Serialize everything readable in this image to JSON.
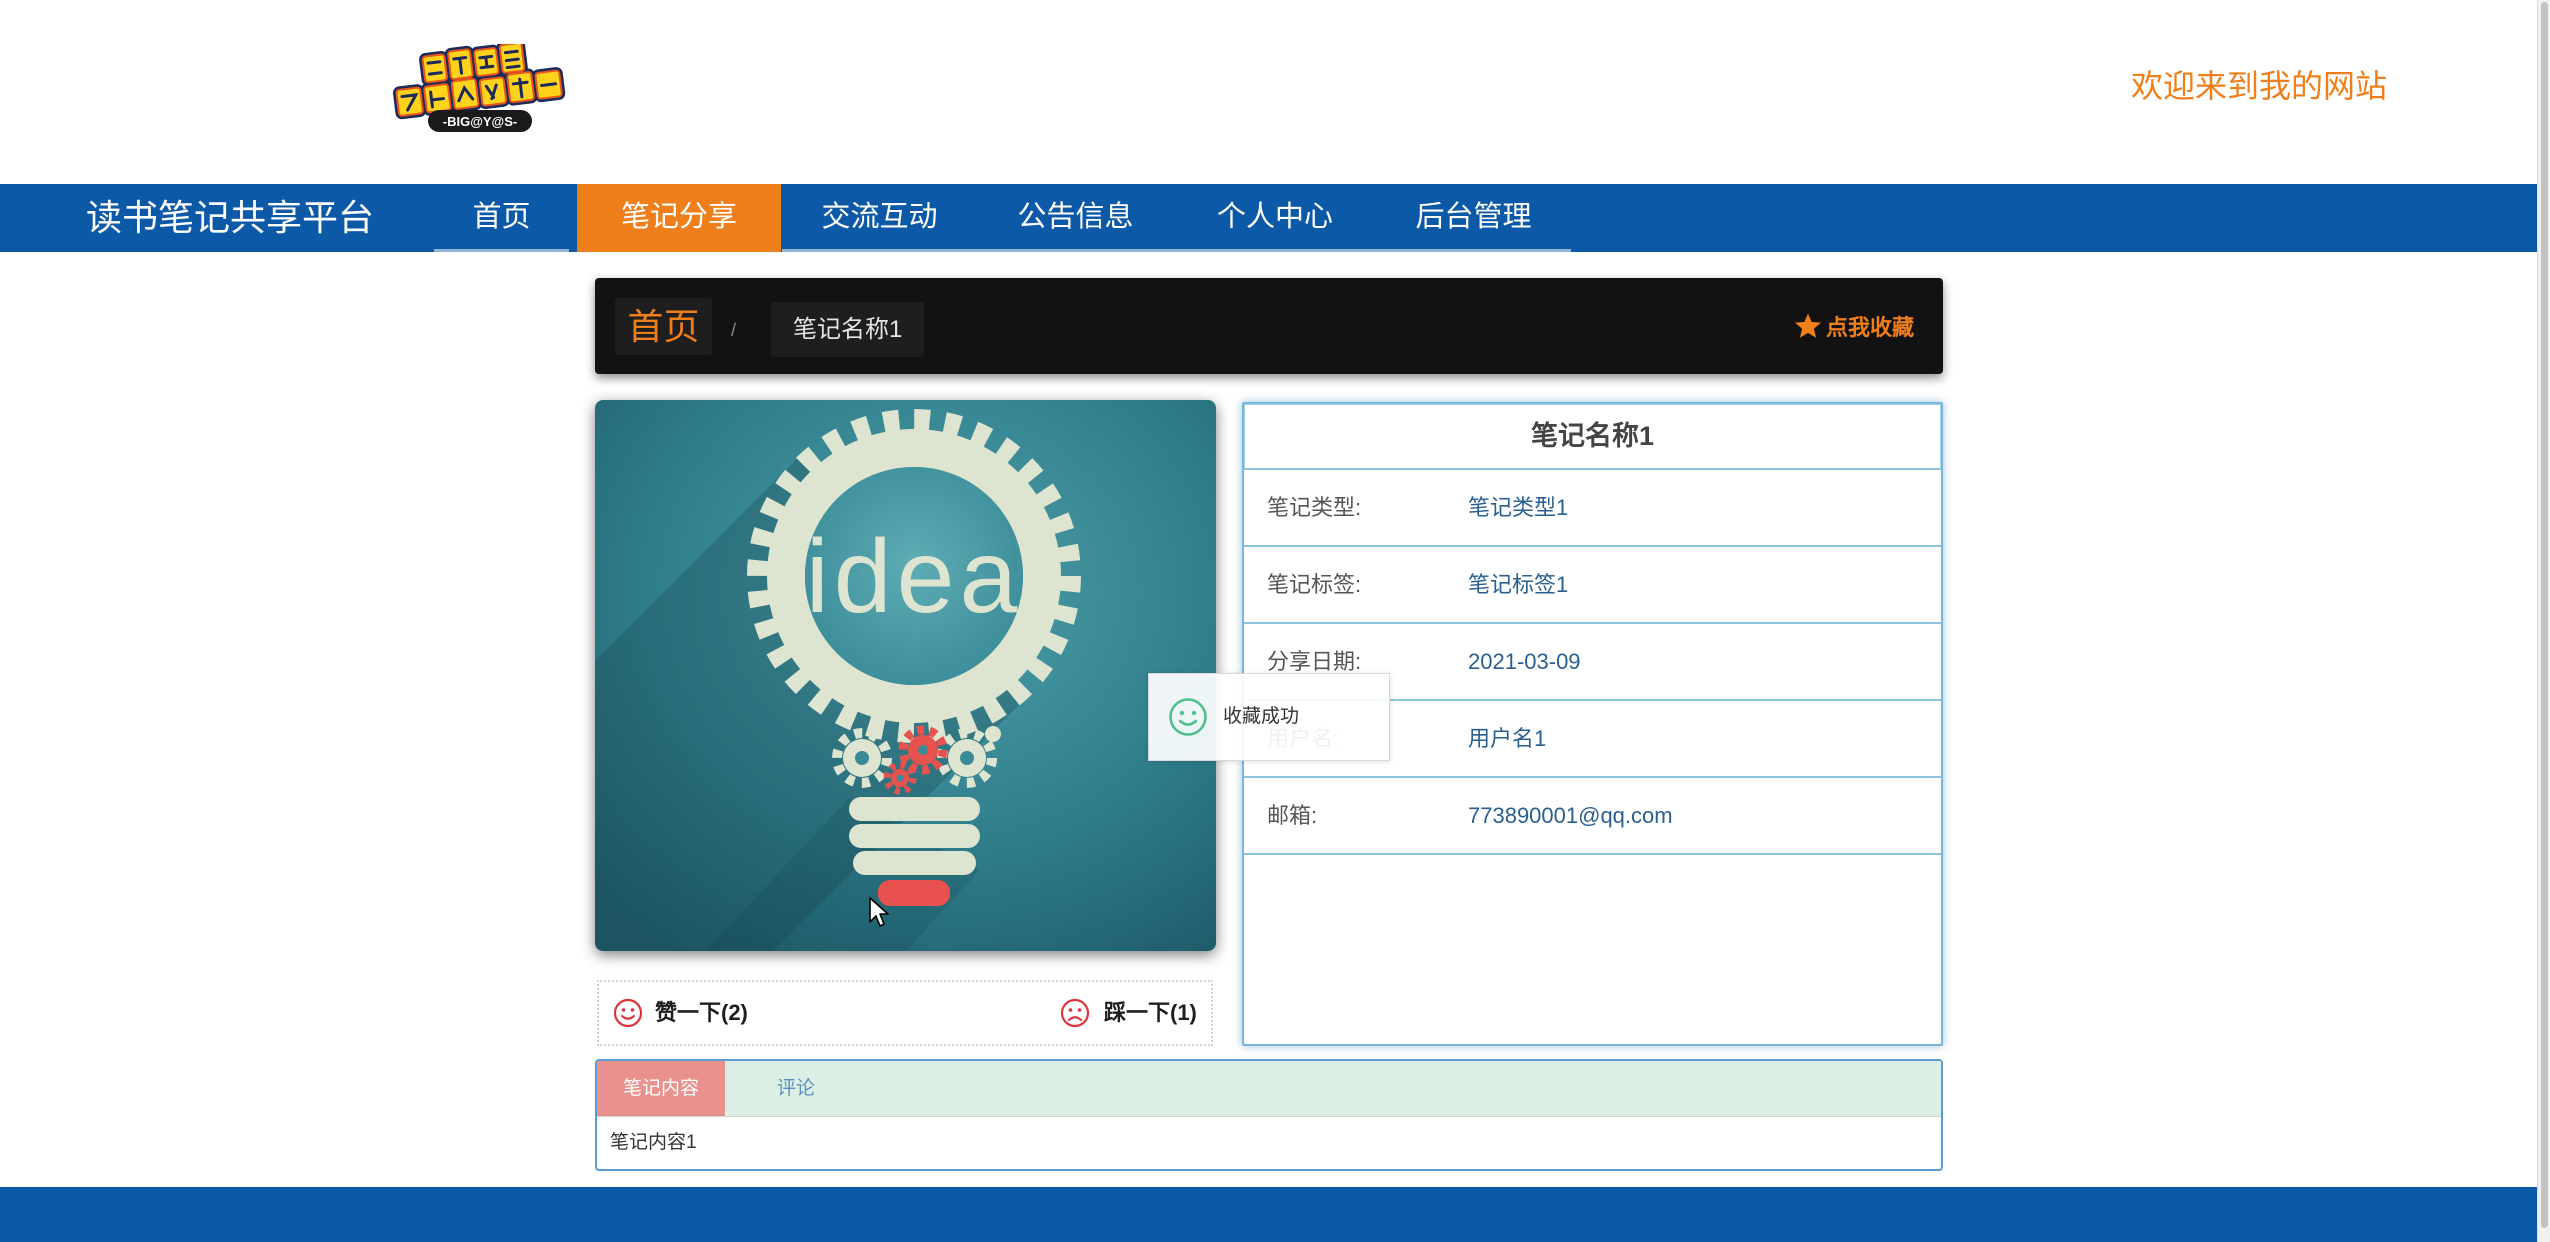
{
  "header": {
    "logo_text": "-BIG@Y@S-",
    "welcome": "欢迎来到我的网站"
  },
  "nav": {
    "site_title": "读书笔记共享平台",
    "items": [
      {
        "label": "首页",
        "active": false
      },
      {
        "label": "笔记分享",
        "active": true
      },
      {
        "label": "交流互动",
        "active": false
      },
      {
        "label": "公告信息",
        "active": false
      },
      {
        "label": "个人中心",
        "active": false
      },
      {
        "label": "后台管理",
        "active": false
      }
    ]
  },
  "breadcrumb": {
    "home": "首页",
    "separator": "/",
    "current": "笔记名称1",
    "favorite_label": "点我收藏",
    "favorite_icon": "star-icon"
  },
  "cover_image": {
    "word": "idea"
  },
  "votes": {
    "like": {
      "label": "赞一下(2)",
      "icon": "smile-icon"
    },
    "dislike": {
      "label": "踩一下(1)",
      "icon": "frown-icon"
    }
  },
  "detail": {
    "title": "笔记名称1",
    "rows": [
      {
        "label": "笔记类型:",
        "value": "笔记类型1"
      },
      {
        "label": "笔记标签:",
        "value": "笔记标签1"
      },
      {
        "label": "分享日期:",
        "value": "2021-03-09"
      },
      {
        "label": "用户名:",
        "value": "用户名1"
      },
      {
        "label": "邮箱:",
        "value": "773890001@qq.com"
      }
    ]
  },
  "toast": {
    "message": "收藏成功",
    "icon": "smile-icon"
  },
  "tabs": {
    "items": [
      {
        "label": "笔记内容",
        "active": true
      },
      {
        "label": "评论",
        "active": false
      }
    ],
    "content": "笔记内容1"
  },
  "colors": {
    "nav_bg": "#0c59a7",
    "accent": "#ee7f1a",
    "crumb_bg": "#121212",
    "detail_border": "#79b6dc",
    "detail_line": "#8ec3df",
    "value_text": "#2a6090",
    "tab_border": "#5b9dd3",
    "tab_header_bg": "#dcefe5",
    "tab_active_bg": "#e8918d",
    "vote_icon": "#d9363e",
    "toast_icon": "#4cbf8a"
  }
}
